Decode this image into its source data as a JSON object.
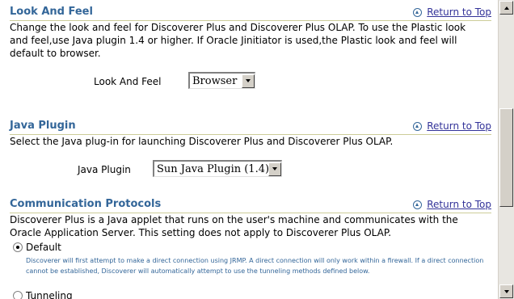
{
  "sections": {
    "look_and_feel": {
      "title": "Look And Feel",
      "return_to_top": "Return to Top",
      "description": "Change the look and feel for Discoverer Plus and Discoverer Plus OLAP. To use the Plastic look and feel,use Java plugin 1.4 or higher. If Oracle Jinitiator is used,the Plastic look and feel will default to browser.",
      "field_label": "Look And Feel",
      "selected_value": "Browser"
    },
    "java_plugin": {
      "title": "Java Plugin",
      "return_to_top": "Return to Top",
      "description": "Select the Java plug-in for launching Discoverer Plus and Discoverer Plus OLAP.",
      "field_label": "Java Plugin",
      "selected_value": "Sun Java Plugin (1.4)"
    },
    "communication_protocols": {
      "title": "Communication Protocols",
      "return_to_top": "Return to Top",
      "description": "Discoverer Plus is a Java applet that runs on the user's machine and communicates with the Oracle Application Server. This setting does not apply to Discoverer Plus OLAP.",
      "options": [
        {
          "label": "Default",
          "checked": true,
          "hint": "Discoverer will first attempt to make a direct connection using JRMP. A direct connection will only work within a firewall. If a direct connection cannot be established, Discoverer will automatically attempt to use the tunneling methods defined below."
        },
        {
          "label": "Tunneling",
          "checked": false
        }
      ]
    }
  },
  "colors": {
    "section_title": "#336699",
    "link": "#333399",
    "rule": "#cccc99",
    "hint_text": "#336699"
  },
  "icons": {
    "return_to_top": "up-arrow-circle-icon",
    "dropdown": "chevron-down-icon",
    "scroll_up": "scroll-up-arrow-icon",
    "scroll_down": "scroll-down-arrow-icon"
  }
}
